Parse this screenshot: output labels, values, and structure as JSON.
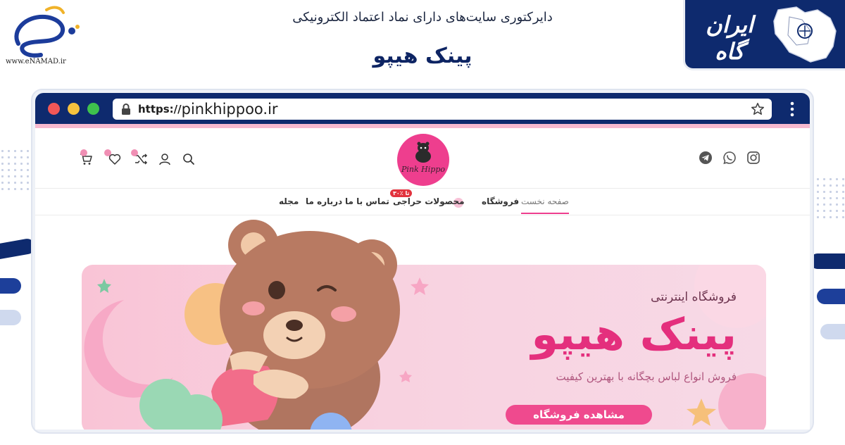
{
  "banner": {
    "directory_title": "دایرکتوری سایت‌های دارای نماد اعتماد الکترونیکی",
    "site_title": "پینک هیپو",
    "enamad_caption": "www.eNAMAD.ir",
    "iran_brand": "ایران گاه"
  },
  "browser": {
    "url_protocol": "https://",
    "url_host": "pinkhippoo.ir"
  },
  "site": {
    "brand_logo_text": "Pink Hippo",
    "nav": [
      {
        "label": "صفحه نخست",
        "active": true
      },
      {
        "label": "فروشگاه"
      },
      {
        "label": "محصولات حراجی",
        "badge": "۳۰٪ تا"
      },
      {
        "label": "تماس با ما"
      },
      {
        "label": "درباره ما"
      },
      {
        "label": "مجله"
      }
    ],
    "header_icons_left": [
      "search-icon",
      "user-icon",
      "compare-icon",
      "wishlist-icon",
      "cart-icon"
    ],
    "header_icons_right": [
      "instagram-icon",
      "whatsapp-icon",
      "telegram-icon"
    ]
  },
  "hero": {
    "kicker": "فروشگاه اینترنتی",
    "title": "پینک هیپو",
    "subtitle": "فروش انواع لباس بچگانه با بهترین کیفیت",
    "button": "مشاهده فروشگاه"
  },
  "colors": {
    "navy": "#0e2a6e",
    "brand_pink": "#ee3e8e",
    "hero_pink": "#f9c4d6",
    "sale_red": "#e2333e"
  }
}
